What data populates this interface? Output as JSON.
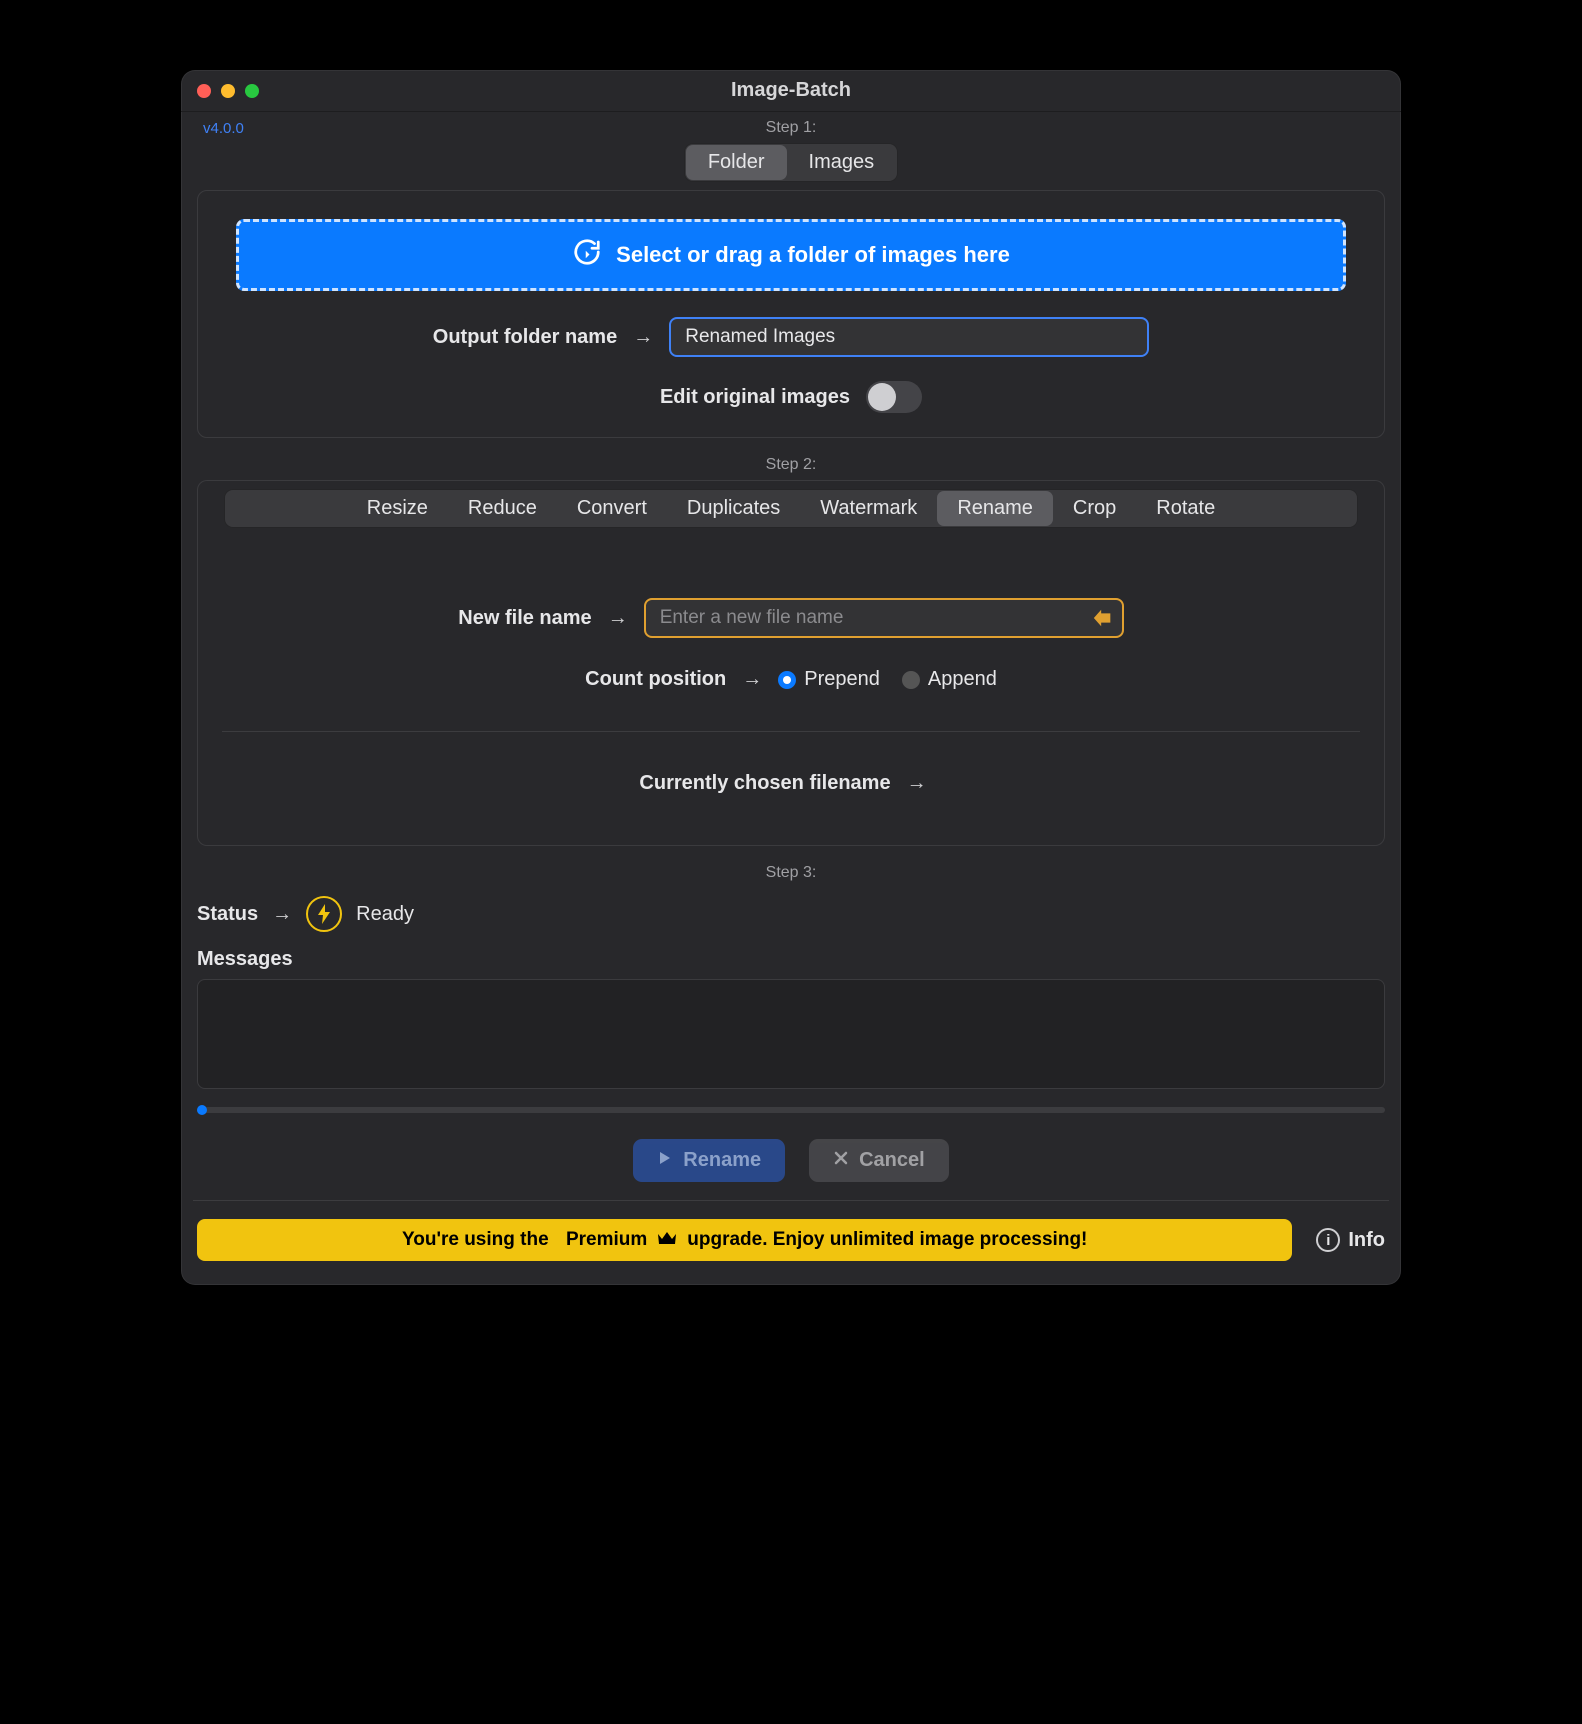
{
  "window": {
    "title": "Image-Batch",
    "version": "v4.0.0"
  },
  "step1": {
    "label": "Step 1:",
    "segments": {
      "folder": "Folder",
      "images": "Images",
      "active": "folder"
    },
    "dropzone_text": "Select or drag a folder of images here",
    "output_folder_label": "Output folder name",
    "output_folder_value": "Renamed Images",
    "edit_original_label": "Edit original images",
    "edit_original_checked": false
  },
  "step2": {
    "label": "Step 2:",
    "tabs": [
      "Resize",
      "Reduce",
      "Convert",
      "Duplicates",
      "Watermark",
      "Rename",
      "Crop",
      "Rotate"
    ],
    "active_tab": "Rename",
    "rename": {
      "new_name_label": "New file name",
      "new_name_placeholder": "Enter a new file name",
      "new_name_value": "",
      "count_position_label": "Count position",
      "count_options": {
        "prepend": "Prepend",
        "append": "Append"
      },
      "count_selected": "prepend",
      "chosen_label": "Currently chosen filename",
      "chosen_value": ""
    }
  },
  "step3": {
    "label": "Step 3:",
    "status_label": "Status",
    "status_value": "Ready",
    "messages_label": "Messages",
    "progress_percent": 0
  },
  "actions": {
    "primary": "Rename",
    "cancel": "Cancel"
  },
  "footer": {
    "premium_prefix": "You're using the",
    "premium_word": "Premium",
    "premium_suffix": "upgrade. Enjoy unlimited image processing!",
    "info": "Info"
  }
}
